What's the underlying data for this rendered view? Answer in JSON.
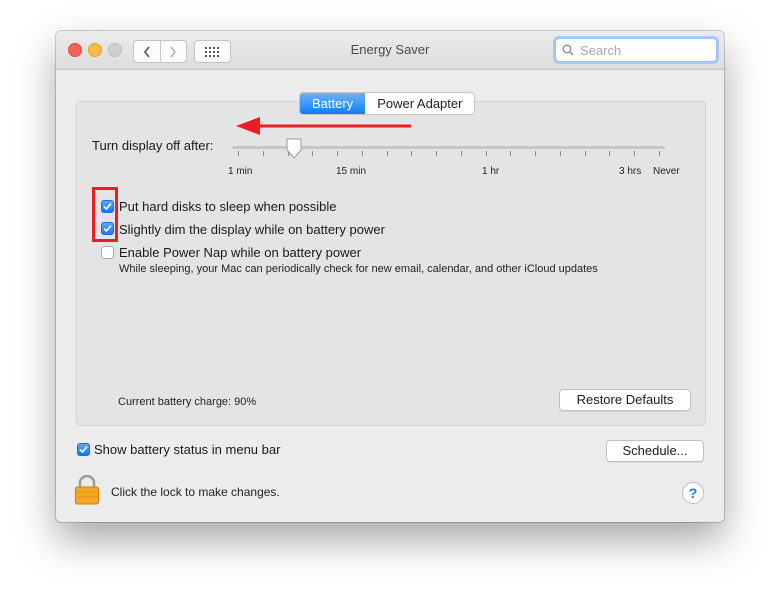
{
  "window": {
    "title": "Energy Saver"
  },
  "search": {
    "placeholder": "Search"
  },
  "tabs": [
    {
      "label": "Battery",
      "active": true
    },
    {
      "label": "Power Adapter",
      "active": false
    }
  ],
  "slider": {
    "label": "Turn display off after:",
    "tick_labels": [
      "1 min",
      "15 min",
      "1 hr",
      "3 hrs",
      "Never"
    ],
    "value": "2 min"
  },
  "options": [
    {
      "label": "Put hard disks to sleep when possible",
      "checked": true
    },
    {
      "label": "Slightly dim the display while on battery power",
      "checked": true
    },
    {
      "label": "Enable Power Nap while on battery power",
      "checked": false,
      "sublabel": "While sleeping, your Mac can periodically check for new email, calendar, and other iCloud updates"
    }
  ],
  "battery_charge": "Current battery charge: 90%",
  "restore_label": "Restore Defaults",
  "menu_bar_option": {
    "label": "Show battery status in menu bar",
    "checked": true
  },
  "schedule_label": "Schedule...",
  "lock_label": "Click the lock to make changes.",
  "help_label": "?",
  "colors": {
    "accent": "#1578f3",
    "annotation_red": "#ee1c24"
  },
  "icons": [
    "back-icon",
    "forward-icon",
    "grid-icon",
    "search-icon",
    "lock-icon",
    "help-icon"
  ]
}
